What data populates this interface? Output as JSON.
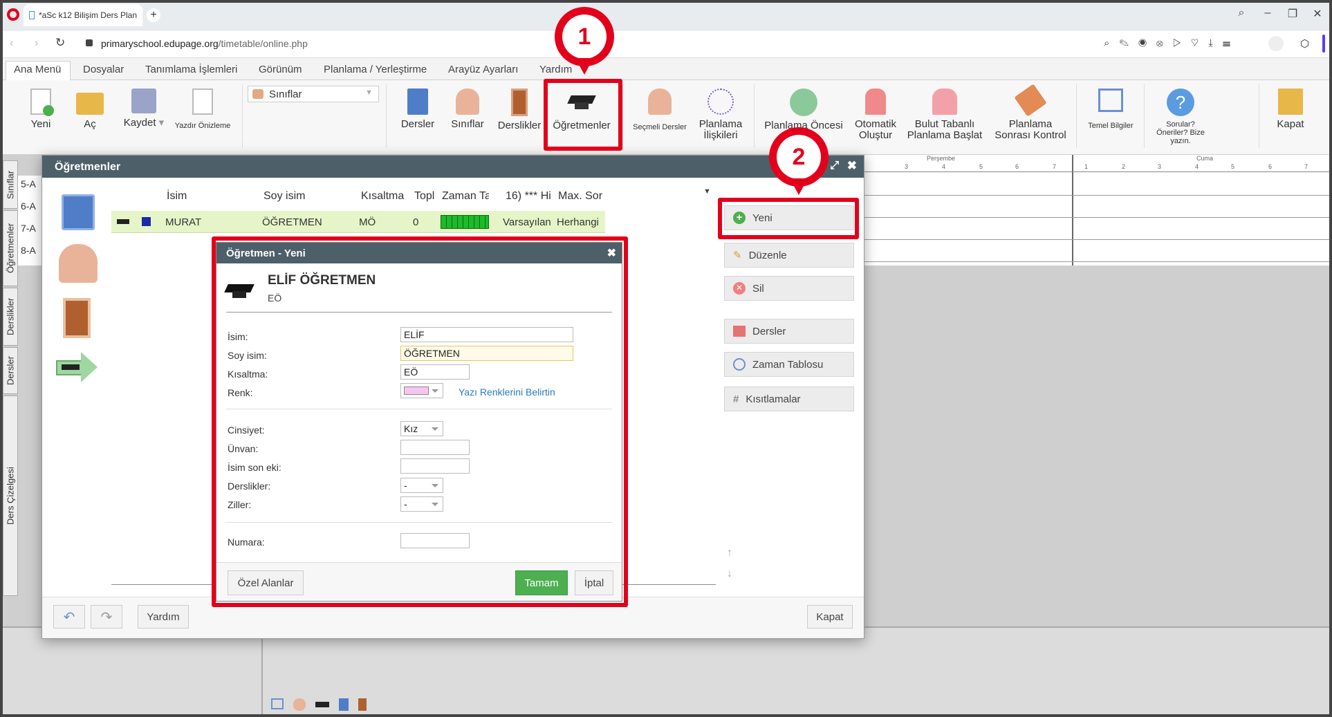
{
  "browser": {
    "tab_title": "*aSc k12 Bilişim Ders Plan",
    "url_host": "primaryschool.edupage.org",
    "url_path": "/timetable/online.php"
  },
  "menu": [
    "Ana Menü",
    "Dosyalar",
    "Tanımlama İşlemleri",
    "Görünüm",
    "Planlama / Yerleştirme",
    "Arayüz Ayarları",
    "Yardım"
  ],
  "ribbon": {
    "yeni": "Yeni",
    "ac": "Aç",
    "kaydet": "Kaydet",
    "yazdir": "Yazdır Önizleme",
    "select_value": "Sınıflar",
    "dersler": "Dersler",
    "siniflar": "Sınıflar",
    "derslikler": "Derslikler",
    "ogretmenler": "Öğretmenler",
    "secmeli": "Seçmeli Dersler",
    "planlama_iliskileri_1": "Planlama",
    "planlama_iliskileri_2": "İlişkileri",
    "planlama_oncesi": "Planlama Öncesi",
    "otomatik_1": "Otomatik",
    "otomatik_2": "Oluştur",
    "bulut_1": "Bulut Tabanlı",
    "bulut_2": "Planlama Başlat",
    "sonrasi_1": "Planlama",
    "sonrasi_2": "Sonrası Kontrol",
    "temel": "Temel Bilgiler",
    "sorular_1": "Sorular?",
    "sorular_2": "Öneriler? Bize",
    "sorular_3": "yazın.",
    "kapat": "Kapat"
  },
  "side_tabs": [
    "Sınıflar",
    "Öğretmenler",
    "Derslikler",
    "Dersler",
    "Ders Çizelgesi"
  ],
  "classes": [
    "5-A",
    "6-A",
    "7-A",
    "8-A"
  ],
  "grid": {
    "days": [
      "Perşembe",
      "Cuma"
    ],
    "periods": [
      "1",
      "2",
      "3",
      "4",
      "5",
      "6",
      "7"
    ]
  },
  "dialog": {
    "title": "Öğretmenler",
    "columns": [
      "İsim",
      "Soy isim",
      "Kısaltma",
      "Topl",
      "Zaman Tab",
      "16) *** Hi",
      "Max. Sor"
    ],
    "row": {
      "name": "MURAT",
      "surname": "ÖĞRETMEN",
      "abbr": "MÖ",
      "total": "0",
      "default": "Varsayılan",
      "any": "Herhangi"
    },
    "side_buttons": [
      "Yeni",
      "Düzenle",
      "Sil",
      "Dersler",
      "Zaman Tablosu",
      "Kısıtlamalar"
    ],
    "yardim": "Yardım",
    "kapat": "Kapat"
  },
  "sub": {
    "title": "Öğretmen - Yeni",
    "full_name": "ELİF ÖĞRETMEN",
    "short": "EÖ",
    "labels": {
      "isim": "İsim:",
      "soyisim": "Soy isim:",
      "kisaltma": "Kısaltma:",
      "renk": "Renk:",
      "cinsiyet": "Cinsiyet:",
      "unvan": "Ünvan:",
      "isim_son_eki": "İsim son eki:",
      "derslikler": "Derslikler:",
      "ziller": "Ziller:",
      "numara": "Numara:"
    },
    "values": {
      "isim": "ELİF",
      "soyisim": "ÖĞRETMEN",
      "kisaltma": "EÖ",
      "cinsiyet": "Kız",
      "derslikler": "-",
      "ziller": "-"
    },
    "text_colors_link": "Yazı Renklerini Belirtin",
    "ozel_alanlar": "Özel Alanlar",
    "tamam": "Tamam",
    "iptal": "İptal",
    "color_swatch": "#f6c6f0"
  },
  "callouts": [
    "1",
    "2"
  ],
  "colors": {
    "accent": "#e3001b",
    "title_bar": "#4d5f69",
    "ok_green": "#4caf50",
    "row_bg": "#e6f5c8"
  }
}
